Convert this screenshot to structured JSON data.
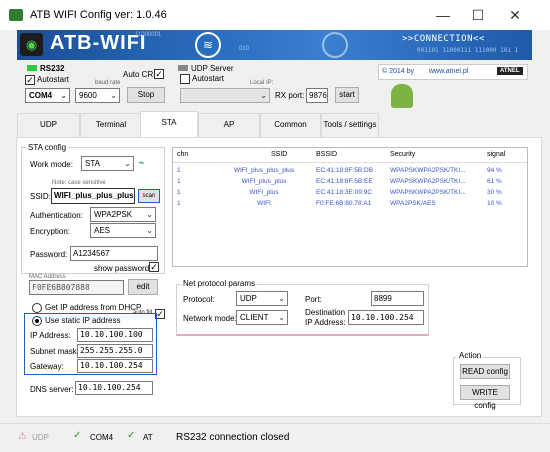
{
  "window": {
    "title": "ATB WIFI Config ver: 1.0.46",
    "minimize": "—",
    "maximize": "☐",
    "close": "✕"
  },
  "banner": {
    "brand": "ATB-WIFI",
    "connection": ">>CONNECTION<<",
    "bits": "001101 11000111 111000 101 1",
    "bits_top": "11000001",
    "bits_mid": "010"
  },
  "rs232": {
    "title": "RS232",
    "autostart": "Autostart",
    "autocr": "Auto CR",
    "baudrate_label": "baud rate",
    "port": "COM4",
    "baud": "9600",
    "stop": "Stop"
  },
  "udp_server": {
    "title": "UDP Server",
    "autostart": "Autostart",
    "local_ip_label": "Local IP:",
    "local_ip": "",
    "rx_port_label": "RX port:",
    "rx_port": "9876",
    "start": "start"
  },
  "copyright": {
    "text": "© 2014 by",
    "url": "www.atnel.pl",
    "logo": "ATNEL"
  },
  "tabs": [
    {
      "label": "UDP"
    },
    {
      "label": "Terminal"
    },
    {
      "label": "STA"
    },
    {
      "label": "AP"
    },
    {
      "label": "Common"
    },
    {
      "label": "Tools / settings"
    }
  ],
  "sta": {
    "group_title": "STA config",
    "work_mode_label": "Work mode:",
    "work_mode": "STA",
    "case_note": "Note: case sensitive",
    "ssid_label": "SSID:",
    "ssid": "WIFI_plus_plus_plus",
    "scan": "scan",
    "auth_label": "Authentication:",
    "auth": "WPA2PSK",
    "enc_label": "Encryption:",
    "enc": "AES",
    "password_label": "Password:",
    "password": "A1234567",
    "show_password": "show password",
    "mac_label": "MAC Address",
    "mac": "F0FE6B807888",
    "edit": "edit",
    "dhcp": "Get IP address from DHCP",
    "autofill": "auto fill",
    "static": "Use static IP address",
    "ip_label": "IP Address:",
    "ip": "10.10.100.100",
    "mask_label": "Subnet mask:",
    "mask": "255.255.255.0",
    "gw_label": "Gateway:",
    "gw": "10.10.100.254",
    "dns_label": "DNS server:",
    "dns": "10.10.100.254"
  },
  "scan_table": {
    "headers": [
      "chn",
      "SSID",
      "BSSID",
      "Security",
      "signal"
    ],
    "rows": [
      [
        "1",
        "WIFI_plus_plus_plus",
        "EC:41:18:8F:5B:DB",
        "WPAPSKWPA2PSK/TKI...",
        "94 %"
      ],
      [
        "1",
        "WIFI_plus_plus",
        "EC:41:18:8F:5B:EE",
        "WPAPSKWPA2PSK/TKI...",
        "61 %"
      ],
      [
        "1",
        "WIFI_plus",
        "EC:41:18:3E:09:9C",
        "WPAPSKWPA2PSK/TKI...",
        "30 %"
      ],
      [
        "1",
        "WIFI",
        "F0:FE:6B:80:78:A1",
        "WPA2PSK/AES",
        "10 %"
      ]
    ]
  },
  "net": {
    "title": "Net protocol params",
    "protocol_label": "Protocol:",
    "protocol": "UDP",
    "port_label": "Port:",
    "port": "8899",
    "mode_label": "Network mode:",
    "mode": "CLIENT",
    "dest_label1": "Destination",
    "dest_label2": "IP Address:",
    "dest": "10.10.100.254"
  },
  "action": {
    "title": "Action",
    "read": "READ config",
    "write": "WRITE config"
  },
  "status": {
    "udp": "UDP",
    "com": "COM4",
    "at": "AT",
    "message": "RS232 connection closed"
  }
}
